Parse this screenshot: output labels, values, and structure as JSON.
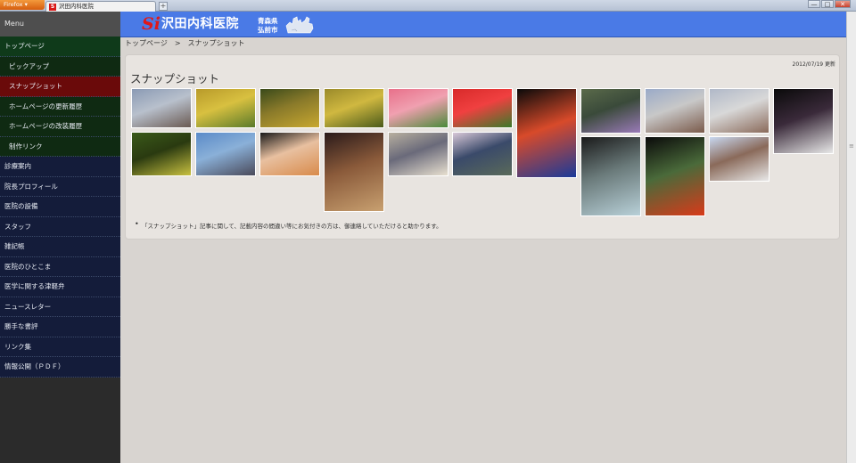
{
  "browser": {
    "app_button": "Firefox",
    "tab_title": "沢田内科医院",
    "tab_favicon": "favicon-si",
    "new_tab": "+",
    "controls": [
      "—",
      "□",
      "✕"
    ]
  },
  "sidebar": {
    "heading": "Menu",
    "items": [
      {
        "label": "トップページ",
        "kind": "top"
      },
      {
        "label": "ピックアップ",
        "kind": "sub"
      },
      {
        "label": "スナップショット",
        "kind": "sub-active"
      },
      {
        "label": "ホームページの更新履歴",
        "kind": "sub"
      },
      {
        "label": "ホームページの改装履歴",
        "kind": "sub"
      },
      {
        "label": "制作リンク",
        "kind": "sub"
      },
      {
        "label": "診療案内",
        "kind": "main"
      },
      {
        "label": "院長プロフィール",
        "kind": "main"
      },
      {
        "label": "医院の設備",
        "kind": "main"
      },
      {
        "label": "スタッフ",
        "kind": "main"
      },
      {
        "label": "雑記帳",
        "kind": "main"
      },
      {
        "label": "医院のひとこま",
        "kind": "main"
      },
      {
        "label": "医学に関する津軽弁",
        "kind": "main"
      },
      {
        "label": "ニュースレター",
        "kind": "main"
      },
      {
        "label": "勝手な書評",
        "kind": "main"
      },
      {
        "label": "リンク集",
        "kind": "main"
      },
      {
        "label": "情報公開（ＰＤＦ）",
        "kind": "main"
      }
    ]
  },
  "header": {
    "logo_mark": "Si",
    "logo_text": "沢田内科医院",
    "prefecture": "青森県",
    "city": "弘前市",
    "map_icon": "aomori-map-icon"
  },
  "breadcrumb": {
    "home": "トップページ",
    "separator": ">",
    "current": "スナップショット"
  },
  "content": {
    "updated": "2012/07/19 更新",
    "title": "スナップショット",
    "note": "「スナップショット」記事に関して、記載内容の間違い等にお気付きの方は、御連絡していただけると助かります。",
    "photos": [
      {
        "subject": "clinic building",
        "colors": [
          "#8a9ab4",
          "#6a5a52",
          "#b8c0cc"
        ]
      },
      {
        "subject": "rice paddy art",
        "colors": [
          "#b89a2a",
          "#5a7a2a",
          "#d8c040"
        ]
      },
      {
        "subject": "rice paddy art wave",
        "colors": [
          "#3a4a1a",
          "#c8a830",
          "#8a7a2a"
        ]
      },
      {
        "subject": "rice paddy art",
        "colors": [
          "#9a8a2a",
          "#4a5a1a",
          "#d0b840"
        ]
      },
      {
        "subject": "pink tulips",
        "colors": [
          "#e8708a",
          "#4a8a3a",
          "#f0a0b0"
        ]
      },
      {
        "subject": "red tulips",
        "colors": [
          "#d82a2a",
          "#3a7a2a",
          "#f04040"
        ]
      },
      {
        "subject": "nebuta lantern",
        "colors": [
          "#0a0a0a",
          "#1a3a9a",
          "#d84a2a"
        ]
      },
      {
        "subject": "garden flowers",
        "colors": [
          "#5a6a4a",
          "#9a7ab8",
          "#3a4a3a"
        ]
      },
      {
        "subject": "clinic building",
        "colors": [
          "#9aaac8",
          "#7a5a4a",
          "#c8c8c8"
        ]
      },
      {
        "subject": "clinic building",
        "colors": [
          "#b0b8c8",
          "#8a6a5a",
          "#d8d8d8"
        ]
      },
      {
        "subject": "hirosaki castle night",
        "colors": [
          "#0a0a0a",
          "#e8e8e8",
          "#3a2a3a"
        ]
      },
      {
        "subject": "rice paddy art figure",
        "colors": [
          "#3a5a1a",
          "#c8c040",
          "#2a3a10"
        ]
      },
      {
        "subject": "mount iwaki city",
        "colors": [
          "#5a8ac8",
          "#4a4a5a",
          "#8ab0d8"
        ]
      },
      {
        "subject": "nebuta float",
        "colors": [
          "#1a1a1a",
          "#d88a4a",
          "#e8c0a0"
        ]
      },
      {
        "subject": "festival drum",
        "colors": [
          "#2a1a1a",
          "#c8a070",
          "#8a5a3a"
        ]
      },
      {
        "subject": "cat figurine",
        "colors": [
          "#b8b0a0",
          "#e8e0d0",
          "#6a6a7a"
        ]
      },
      {
        "subject": "cherry blossom park",
        "colors": [
          "#d8c8d8",
          "#5a6a5a",
          "#3a4a6a"
        ]
      },
      {
        "subject": "frozen fountain",
        "colors": [
          "#1a1a1a",
          "#b8d0d8",
          "#6a7a7a"
        ]
      },
      {
        "subject": "amaryllis flower",
        "colors": [
          "#0a0a0a",
          "#d83a1a",
          "#4a6a3a"
        ]
      },
      {
        "subject": "snowy street",
        "colors": [
          "#c8d8f0",
          "#e8e8e8",
          "#8a6a5a"
        ]
      }
    ]
  },
  "colors": {
    "header_blue": "#4a7ae6",
    "sidebar_bg": "#141c3a",
    "active_item": "#6a0a0a",
    "top_item": "#0f3a1a"
  }
}
